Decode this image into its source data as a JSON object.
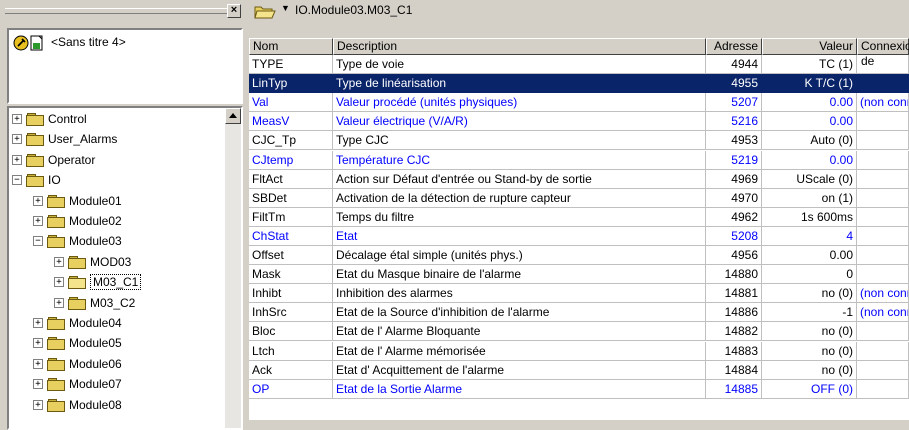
{
  "project": {
    "label": "<Sans titre 4>"
  },
  "tree": [
    {
      "label": "Control",
      "expander": "+",
      "level": 0
    },
    {
      "label": "User_Alarms",
      "expander": "+",
      "level": 0
    },
    {
      "label": "Operator",
      "expander": "+",
      "level": 0
    },
    {
      "label": "IO",
      "expander": "−",
      "level": 0
    },
    {
      "label": "Module01",
      "expander": "+",
      "level": 1
    },
    {
      "label": "Module02",
      "expander": "+",
      "level": 1
    },
    {
      "label": "Module03",
      "expander": "−",
      "level": 1
    },
    {
      "label": "MOD03",
      "expander": "+",
      "level": 2
    },
    {
      "label": "M03_C1",
      "expander": "+",
      "level": 2,
      "selected": true
    },
    {
      "label": "M03_C2",
      "expander": "+",
      "level": 2
    },
    {
      "label": "Module04",
      "expander": "+",
      "level": 1
    },
    {
      "label": "Module05",
      "expander": "+",
      "level": 1
    },
    {
      "label": "Module06",
      "expander": "+",
      "level": 1
    },
    {
      "label": "Module07",
      "expander": "+",
      "level": 1
    },
    {
      "label": "Module08",
      "expander": "+",
      "level": 1
    }
  ],
  "path": {
    "text": "IO.Module03.M03_C1"
  },
  "grid": {
    "headers": {
      "nom": "Nom",
      "description": "Description",
      "adresse": "Adresse",
      "valeur": "Valeur",
      "connexion": "Connexion de"
    },
    "rows": [
      {
        "nom": "TYPE",
        "description": "Type de voie",
        "adresse": "4944",
        "valeur": "TC (1)",
        "connexion": "",
        "style": "normal"
      },
      {
        "nom": "LinTyp",
        "description": "Type de linéarisation",
        "adresse": "4955",
        "valeur": "K T/C (1)",
        "connexion": "",
        "style": "selected"
      },
      {
        "nom": "Val",
        "description": "Valeur procédé (unités physiques)",
        "adresse": "5207",
        "valeur": "0.00",
        "connexion": "(non connecté)",
        "style": "link"
      },
      {
        "nom": "MeasV",
        "description": "Valeur électrique (V/A/R)",
        "adresse": "5216",
        "valeur": "0.00",
        "connexion": "",
        "style": "link"
      },
      {
        "nom": "CJC_Tp",
        "description": "Type CJC",
        "adresse": "4953",
        "valeur": "Auto (0)",
        "connexion": "",
        "style": "normal"
      },
      {
        "nom": "CJtemp",
        "description": "Température CJC",
        "adresse": "5219",
        "valeur": "0.00",
        "connexion": "",
        "style": "link"
      },
      {
        "nom": "FltAct",
        "description": "Action sur Défaut d'entrée ou Stand-by de sortie",
        "adresse": "4969",
        "valeur": "UScale (0)",
        "connexion": "",
        "style": "normal"
      },
      {
        "nom": "SBDet",
        "description": "Activation de la détection de rupture capteur",
        "adresse": "4970",
        "valeur": "on (1)",
        "connexion": "",
        "style": "normal"
      },
      {
        "nom": "FiltTm",
        "description": "Temps du filtre",
        "adresse": "4962",
        "valeur": "1s 600ms",
        "connexion": "",
        "style": "normal"
      },
      {
        "nom": "ChStat",
        "description": "Etat",
        "adresse": "5208",
        "valeur": "4",
        "connexion": "",
        "style": "link"
      },
      {
        "nom": "Offset",
        "description": "Décalage étal simple (unités phys.)",
        "adresse": "4956",
        "valeur": "0.00",
        "connexion": "",
        "style": "normal"
      },
      {
        "nom": "Mask",
        "description": "Etat du Masque binaire de l'alarme",
        "adresse": "14880",
        "valeur": "0",
        "connexion": "",
        "style": "normal"
      },
      {
        "nom": "Inhibt",
        "description": "Inhibition des alarmes",
        "adresse": "14881",
        "valeur": "no (0)",
        "connexion": "(non connecté)",
        "style": "normal"
      },
      {
        "nom": "InhSrc",
        "description": "Etat de la Source d'inhibition de l'alarme",
        "adresse": "14886",
        "valeur": "-1",
        "connexion": "(non connecté)",
        "style": "normal"
      },
      {
        "nom": "Bloc",
        "description": "Etat de l' Alarme Bloquante",
        "adresse": "14882",
        "valeur": "no (0)",
        "connexion": "",
        "style": "normal"
      },
      {
        "nom": "Ltch",
        "description": "Etat de l' Alarme mémorisée",
        "adresse": "14883",
        "valeur": "no (0)",
        "connexion": "",
        "style": "normal"
      },
      {
        "nom": "Ack",
        "description": "Etat d' Acquittement de l'alarme",
        "adresse": "14884",
        "valeur": "no (0)",
        "connexion": "",
        "style": "normal"
      },
      {
        "nom": "OP",
        "description": "Etat de la Sortie Alarme",
        "adresse": "14885",
        "valeur": "OFF (0)",
        "connexion": "",
        "style": "link"
      }
    ]
  },
  "icons": {
    "close": "close-icon",
    "folder": "folder-icon",
    "project": "project-icon",
    "chevron": "chevron-down-icon"
  },
  "colors": {
    "selection": "#0a246a",
    "link": "#0000ff",
    "window": "#d4d0c8"
  }
}
